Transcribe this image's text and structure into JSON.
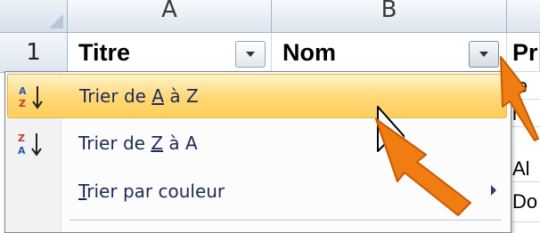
{
  "columns": {
    "a": "A",
    "b": "B"
  },
  "row": {
    "number": "1",
    "cell_a": "Titre",
    "cell_b": "Nom",
    "cell_c": "Pr"
  },
  "column_c_values": [
    "le",
    "r",
    "Al",
    "Do"
  ],
  "menu": {
    "items": [
      {
        "pre": "Trier de ",
        "u": "A",
        "post": " à Z",
        "icon": "sort-az-icon",
        "highlighted": true
      },
      {
        "pre": "Trier de ",
        "u": "Z",
        "post": " à A",
        "icon": "sort-za-icon",
        "highlighted": false
      },
      {
        "pre": "",
        "u": "T",
        "post": "rier par couleur",
        "icon": "",
        "has_submenu": true
      }
    ]
  },
  "colors": {
    "highlight": "#ffd774",
    "annotation_arrow": "#f07c12",
    "header_border": "#9eb6ce"
  }
}
